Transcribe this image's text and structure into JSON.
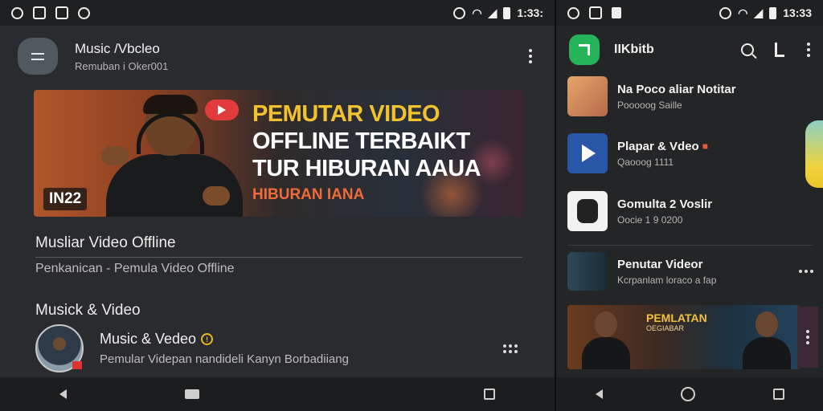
{
  "left": {
    "status": {
      "time": "1:33:"
    },
    "header": {
      "title": "Music /Vbcleo",
      "subtitle": "Remuban i Oker001"
    },
    "banner": {
      "line1": "PEMUTAR VIDEO",
      "line2": "OFFLINE TERBAIKT",
      "line3": "TUR HIBURAN AAUA",
      "line4": "HIBURAN IANA",
      "tag": "IN22"
    },
    "section1": {
      "title": "Musliar Video Offline",
      "subtitle": "Penkanican - Pemula Video Offline"
    },
    "section2": {
      "title": "Musick & Video"
    },
    "app": {
      "name": "Music & Vedeo",
      "description": "Pemular Videpan nandideli Kanyn Borbadiiang"
    }
  },
  "right": {
    "status": {
      "time": "13:33"
    },
    "header": {
      "title": "IIKbitb"
    },
    "items": [
      {
        "title": "Na Poco aliar Notitar",
        "subtitle": "Pooooog Saille"
      },
      {
        "title": "Plapar & Vdeo",
        "subtitle": "Qaooog 1111"
      },
      {
        "title": "Gomulta 2 Voslir",
        "subtitle": "Oocie 1 9 0200"
      },
      {
        "title": "Penutar Videor",
        "subtitle": "Kcrpanlam loraco a fap"
      }
    ],
    "banner": {
      "title": "PEMLATAN",
      "subtitle": "OEGIABAR"
    }
  }
}
